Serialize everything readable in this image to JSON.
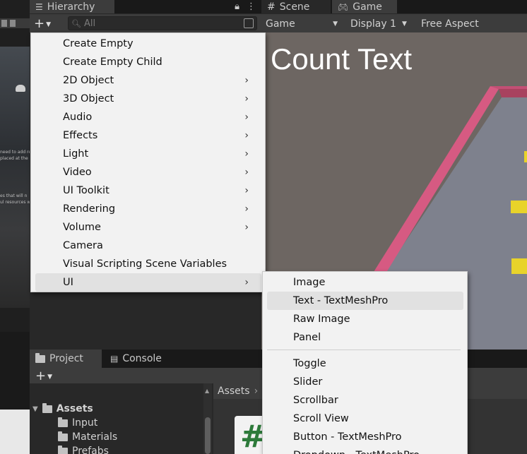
{
  "hierarchy": {
    "tab_label": "Hierarchy",
    "search_placeholder": "All"
  },
  "scene_tabs": {
    "scene_label": "Scene",
    "game_label": "Game"
  },
  "game_toolbar": {
    "view_dropdown": "Game",
    "display_dropdown": "Display 1",
    "aspect_dropdown": "Free Aspect"
  },
  "game_view": {
    "overlay_text": "Count Text",
    "colors": {
      "background": "#6d6662",
      "floor": "#7e818d",
      "wall": "#d65a82",
      "pickup": "#e8d32a"
    }
  },
  "project": {
    "tab_project": "Project",
    "tab_console": "Console",
    "tree": [
      {
        "label": "Assets",
        "expanded": true
      },
      {
        "label": "Input"
      },
      {
        "label": "Materials"
      },
      {
        "label": "Prefabs"
      }
    ],
    "breadcrumb": "Assets",
    "asset_glyph": "#"
  },
  "context_menu": {
    "items": [
      {
        "label": "Create Empty",
        "submenu": false
      },
      {
        "label": "Create Empty Child",
        "submenu": false
      },
      {
        "label": "2D Object",
        "submenu": true
      },
      {
        "label": "3D Object",
        "submenu": true
      },
      {
        "label": "Audio",
        "submenu": true
      },
      {
        "label": "Effects",
        "submenu": true
      },
      {
        "label": "Light",
        "submenu": true
      },
      {
        "label": "Video",
        "submenu": true
      },
      {
        "label": "UI Toolkit",
        "submenu": true
      },
      {
        "label": "Rendering",
        "submenu": true
      },
      {
        "label": "Volume",
        "submenu": true
      },
      {
        "label": "Camera",
        "submenu": false
      },
      {
        "label": "Visual Scripting Scene Variables",
        "submenu": false
      },
      {
        "label": "UI",
        "submenu": true,
        "highlighted": true
      }
    ],
    "arrow_glyph": "›"
  },
  "ui_submenu": {
    "group1": [
      {
        "label": "Image"
      },
      {
        "label": "Text - TextMeshPro",
        "highlighted": true
      },
      {
        "label": "Raw Image"
      },
      {
        "label": "Panel"
      }
    ],
    "group2": [
      {
        "label": "Toggle"
      },
      {
        "label": "Slider"
      },
      {
        "label": "Scrollbar"
      },
      {
        "label": "Scroll View"
      },
      {
        "label": "Button - TextMeshPro"
      },
      {
        "label": "Dropdown - TextMeshPro"
      }
    ]
  },
  "left_strip": {
    "text_line1": "need to add re",
    "text_line2": "placed at the",
    "text_line3": "es that will n",
    "text_line4": "ul resources w"
  }
}
